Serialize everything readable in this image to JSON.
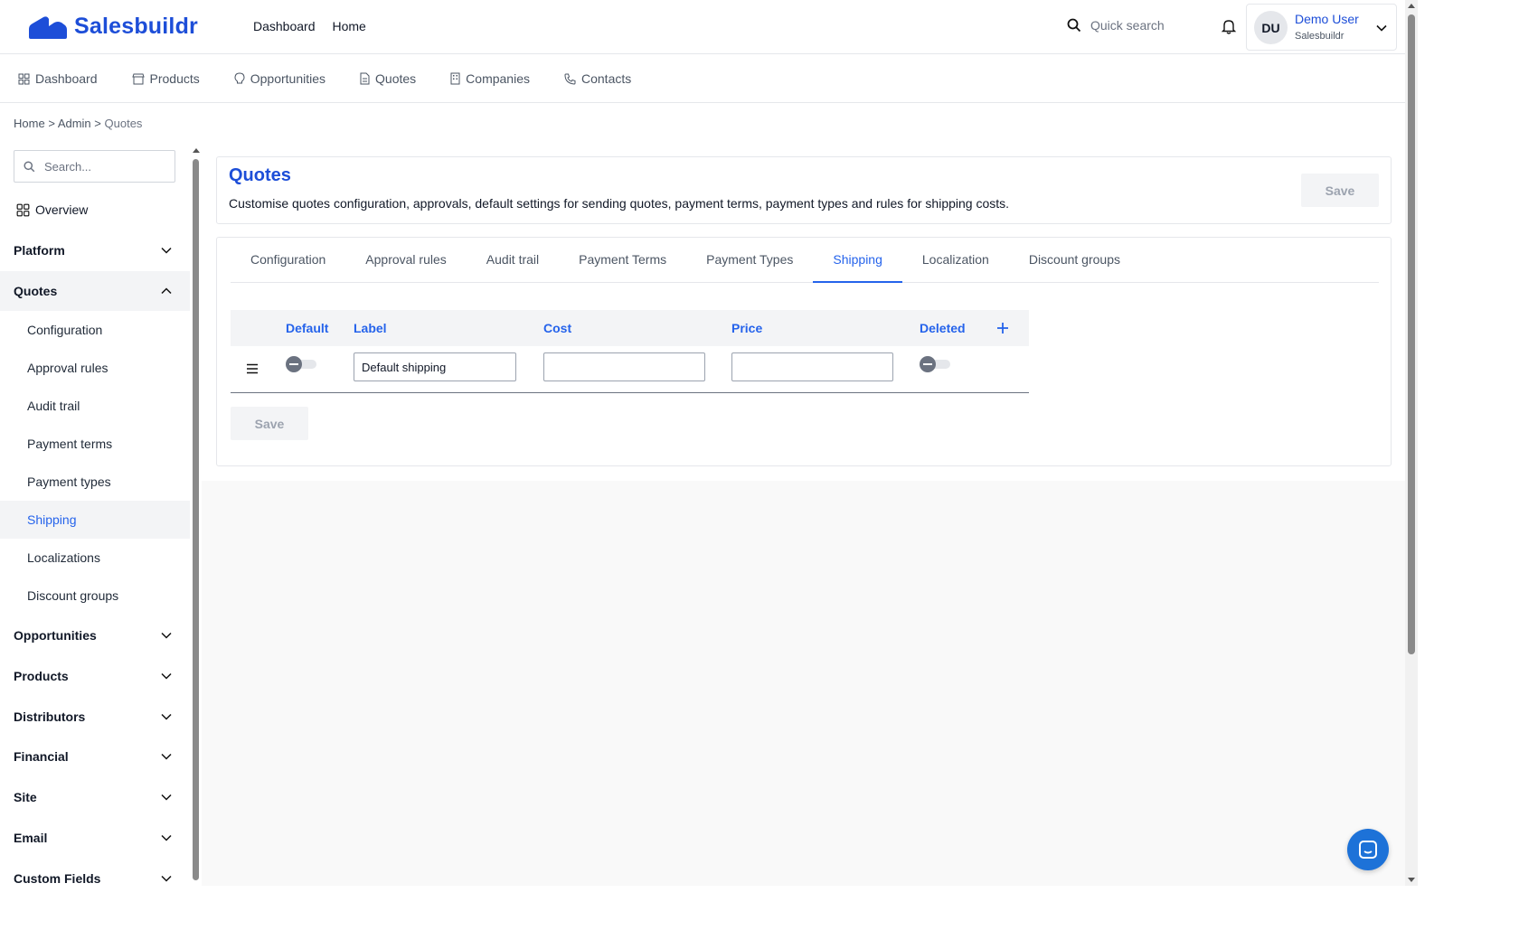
{
  "brand": {
    "name": "Salesbuildr",
    "accent": "#1d4ed8",
    "link": "#2563eb"
  },
  "top_nav": [
    "Dashboard",
    "Home"
  ],
  "search": {
    "placeholder": "Quick search"
  },
  "user": {
    "initials": "DU",
    "name": "Demo User",
    "org": "Salesbuildr"
  },
  "sub_nav": [
    {
      "label": "Dashboard",
      "icon": "grid-icon"
    },
    {
      "label": "Products",
      "icon": "store-icon"
    },
    {
      "label": "Opportunities",
      "icon": "lightbulb-icon"
    },
    {
      "label": "Quotes",
      "icon": "document-icon"
    },
    {
      "label": "Companies",
      "icon": "building-icon"
    },
    {
      "label": "Contacts",
      "icon": "phone-icon"
    }
  ],
  "breadcrumb": {
    "home": "Home",
    "sep": ">",
    "admin": "Admin",
    "current": "Quotes"
  },
  "sidebar": {
    "search_placeholder": "Search...",
    "overview": "Overview",
    "sections": [
      {
        "label": "Platform"
      },
      {
        "label": "Quotes"
      },
      {
        "label": "Opportunities"
      },
      {
        "label": "Products"
      },
      {
        "label": "Distributors"
      },
      {
        "label": "Financial"
      },
      {
        "label": "Site"
      },
      {
        "label": "Email"
      },
      {
        "label": "Custom Fields"
      }
    ],
    "quotes_items": [
      "Configuration",
      "Approval rules",
      "Audit trail",
      "Payment terms",
      "Payment types",
      "Shipping",
      "Localizations",
      "Discount groups"
    ],
    "active_item": "Shipping"
  },
  "page": {
    "title": "Quotes",
    "description": "Customise quotes configuration, approvals, default settings for sending quotes, payment terms, payment types and rules for shipping costs.",
    "save_label": "Save"
  },
  "tabs": [
    "Configuration",
    "Approval rules",
    "Audit trail",
    "Payment Terms",
    "Payment Types",
    "Shipping",
    "Localization",
    "Discount groups"
  ],
  "active_tab": "Shipping",
  "shipping_table": {
    "headers": {
      "default": "Default",
      "label": "Label",
      "cost": "Cost",
      "price": "Price",
      "deleted": "Deleted"
    },
    "rows": [
      {
        "default": false,
        "label": "Default shipping",
        "cost": "",
        "price": "",
        "deleted": false
      }
    ],
    "save_label": "Save"
  }
}
